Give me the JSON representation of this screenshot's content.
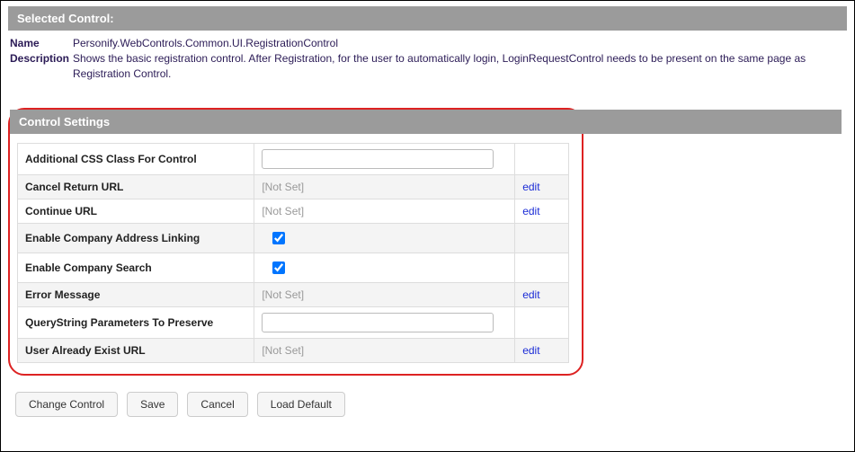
{
  "selected": {
    "header": "Selected Control:",
    "name_label": "Name",
    "name_value": "Personify.WebControls.Common.UI.RegistrationControl",
    "desc_label": "Description",
    "desc_value": "Shows the basic registration control. After Registration, for the user to automatically login, LoginRequestControl needs to be present on the same page as Registration Control."
  },
  "settings": {
    "header": "Control Settings",
    "notset": "[Not Set]",
    "edit_label": "edit",
    "rows": {
      "css_class": "Additional CSS Class For Control",
      "cancel_url": "Cancel Return URL",
      "continue_url": "Continue URL",
      "enable_addr": "Enable Company Address Linking",
      "enable_search": "Enable Company Search",
      "error_msg": "Error Message",
      "qs_preserve": "QueryString Parameters To Preserve",
      "user_exist": "User Already Exist URL"
    }
  },
  "buttons": {
    "change": "Change Control",
    "save": "Save",
    "cancel": "Cancel",
    "load_default": "Load Default"
  }
}
